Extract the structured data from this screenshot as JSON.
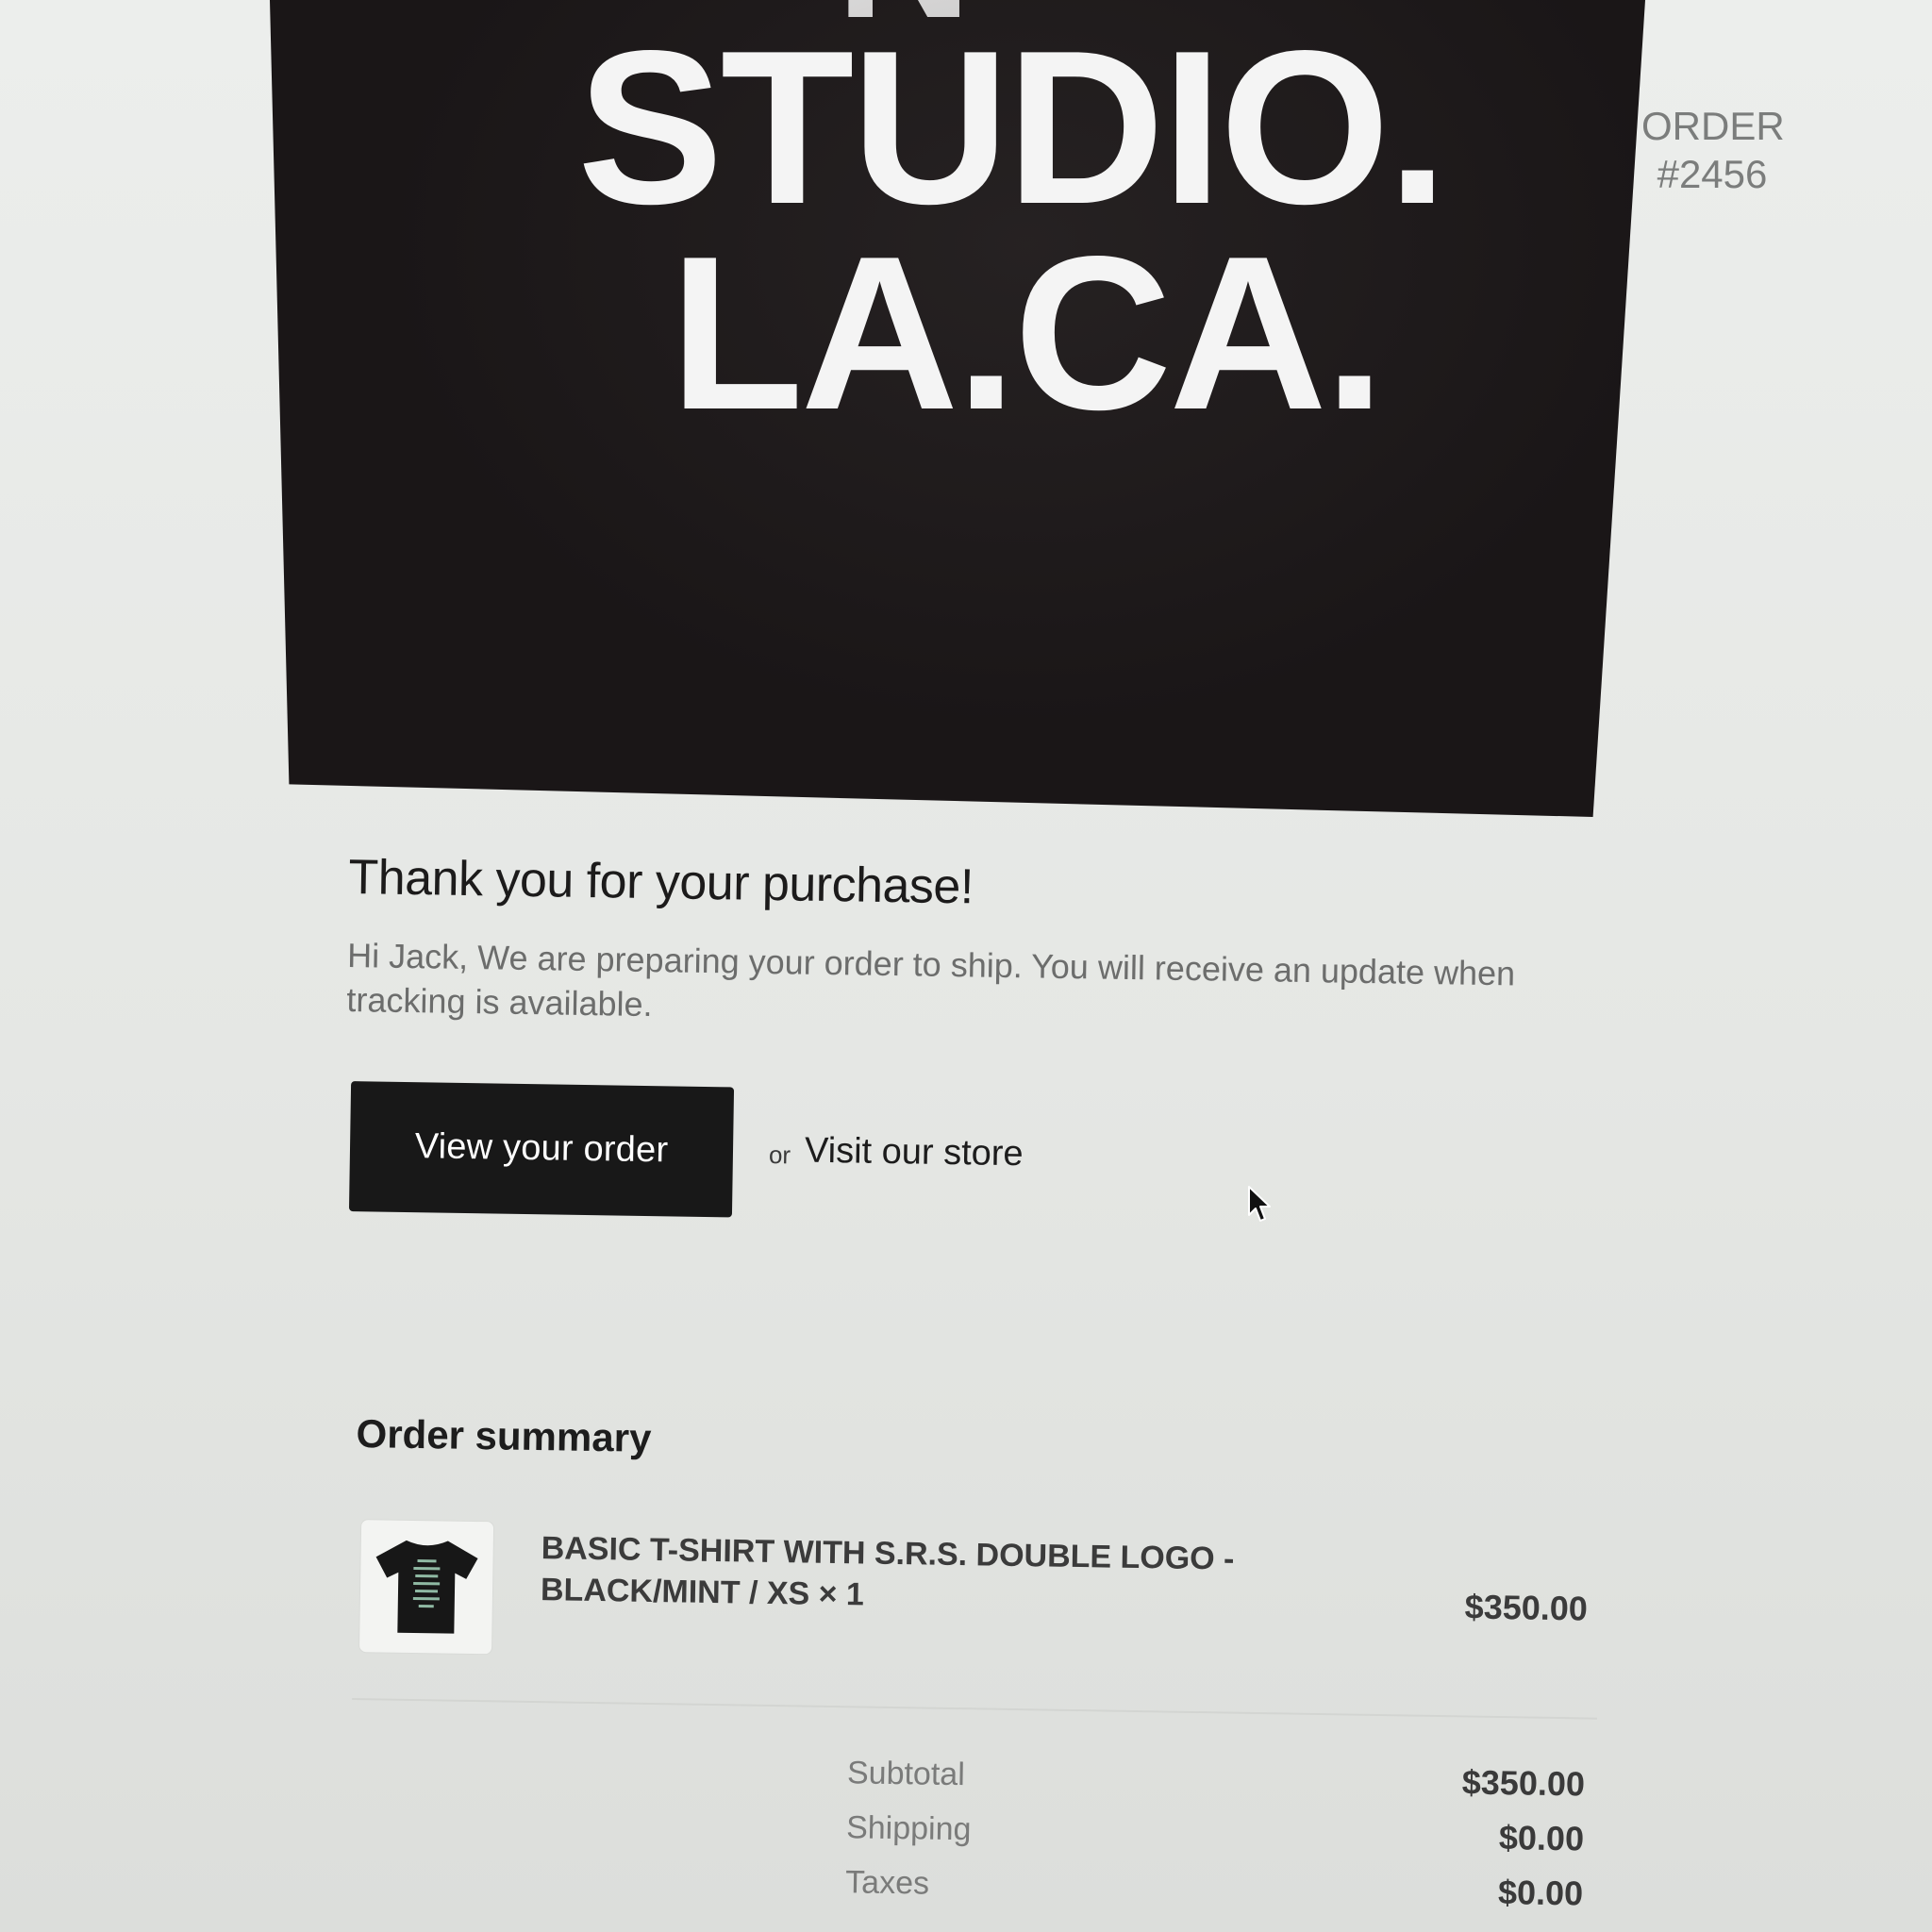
{
  "hero": {
    "line_1": "STUDIO.",
    "line_2": "LA.CA.",
    "fragment": "N"
  },
  "order": {
    "label": "ORDER",
    "number": "#2456"
  },
  "message": {
    "heading": "Thank you for your purchase!",
    "body": "Hi Jack, We are preparing your order to ship. You will receive an update when tracking is available."
  },
  "actions": {
    "view_order_label": "View your order",
    "or_label": "or",
    "visit_store_label": "Visit our store"
  },
  "summary": {
    "title": "Order summary",
    "items": [
      {
        "title": "BASIC T-SHIRT WITH S.R.S. DOUBLE LOGO - BLACK/MINT / XS × 1",
        "price": "$350.00",
        "thumbnail_icon": "tshirt-icon"
      }
    ],
    "totals": [
      {
        "label": "Subtotal",
        "value": "$350.00"
      },
      {
        "label": "Shipping",
        "value": "$0.00"
      },
      {
        "label": "Taxes",
        "value": "$0.00"
      }
    ]
  },
  "colors": {
    "hero_background": "#1a1617",
    "button_background": "#181818",
    "page_background": "#e6e7e4"
  }
}
